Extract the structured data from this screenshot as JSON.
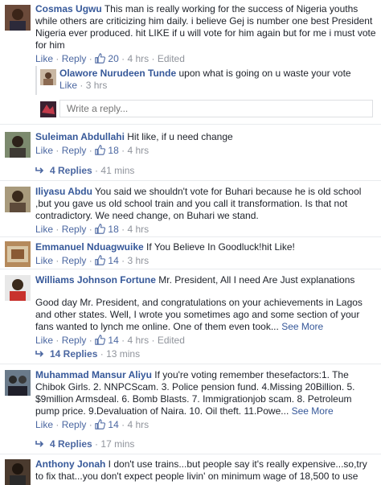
{
  "comments": [
    {
      "name": "Cosmas Ugwu",
      "text": "This man is really working for the success of Nigeria youths while others are criticizing him daily. i believe Gej is number one best President Nigeria ever produced. hit LIKE if u will vote for him again but for me i must vote for him",
      "likes": "20",
      "time": "4 hrs",
      "edited": "Edited"
    },
    {
      "name": "Suleiman Abdullahi",
      "text": "Hit like, if u need change",
      "likes": "18",
      "time": "4 hrs",
      "replies": "4 Replies",
      "replies_time": "41 mins"
    },
    {
      "name": "Iliyasu Abdu",
      "text": "You said we shouldn't vote for Buhari because he is old school ,but you gave us old school train and you call it transformation. Is that not contradictory. We need change, on Buhari we stand.",
      "likes": "18",
      "time": "4 hrs"
    },
    {
      "name": "Emmanuel Nduagwuike",
      "text": "If You Believe In Goodluck!hit Like!",
      "likes": "14",
      "time": "3 hrs"
    },
    {
      "name": "Williams Johnson Fortune",
      "text": "Mr. President, All I need Are Just explanations",
      "text2": "Good day Mr. President, and congratulations on your achievements in Lagos and other states. Well, I wrote you sometimes ago and some section of your fans wanted to lynch me online. One of them even took...",
      "see_more": "See More",
      "likes": "14",
      "time": "4 hrs",
      "edited": "Edited",
      "replies": "14 Replies",
      "replies_time": "13 mins"
    },
    {
      "name": "Muhammad Mansur Aliyu",
      "text": "If you're voting remember thesefactors:1. The Chibok Girls. 2. NNPCScam. 3. Police pension fund. 4.Missing 20Billion. 5. $9million Armsdeal. 6. Bomb Blasts. 7. Immigrationjob scam. 8. Petroleum pump price. 9.Devaluation of Naira. 10. Oil theft. 11.Powe...",
      "see_more": "See More",
      "likes": "14",
      "time": "4 hrs",
      "replies": "4 Replies",
      "replies_time": "17 mins"
    },
    {
      "name": "Anthony Jonah",
      "text": "I don't use trains...but people say it's really expensive...so,try to fix that...you don't expect people livin' on minimum wage of 18,500 to use"
    }
  ],
  "reply": {
    "name": "Olawore Nurudeen Tunde",
    "text": "upon what is going on u waste your vote",
    "time": "3 hrs"
  },
  "reply_box": {
    "placeholder": "Write a reply..."
  },
  "labels": {
    "like": "Like",
    "reply": "Reply",
    "dot": "·"
  },
  "colors": {
    "link": "#365899",
    "meta": "#90949c",
    "separator": "#e9ebee"
  }
}
